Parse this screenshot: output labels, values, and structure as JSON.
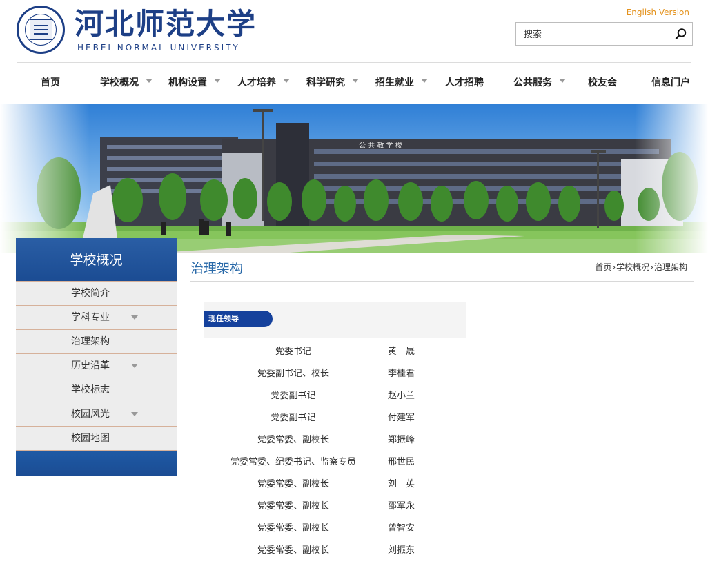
{
  "header": {
    "logo_cn": "河北师范大学",
    "logo_en": "HEBEI NORMAL UNIVERSITY",
    "english_link": "English Version",
    "search_placeholder": "搜索"
  },
  "nav": [
    {
      "label": "首页",
      "dropdown": false
    },
    {
      "label": "学校概况",
      "dropdown": true
    },
    {
      "label": "机构设置",
      "dropdown": true
    },
    {
      "label": "人才培养",
      "dropdown": true
    },
    {
      "label": "科学研究",
      "dropdown": true
    },
    {
      "label": "招生就业",
      "dropdown": true
    },
    {
      "label": "人才招聘",
      "dropdown": false
    },
    {
      "label": "公共服务",
      "dropdown": true
    },
    {
      "label": "校友会",
      "dropdown": false
    },
    {
      "label": "信息门户",
      "dropdown": false
    }
  ],
  "banner": {
    "building_sign": "公 共 教 学 楼"
  },
  "sidebar": {
    "title": "学校概况",
    "items": [
      {
        "label": "学校简介",
        "dropdown": false
      },
      {
        "label": "学科专业",
        "dropdown": true
      },
      {
        "label": "治理架构",
        "dropdown": false
      },
      {
        "label": "历史沿革",
        "dropdown": true
      },
      {
        "label": "学校标志",
        "dropdown": false
      },
      {
        "label": "校园风光",
        "dropdown": true
      },
      {
        "label": "校园地图",
        "dropdown": false
      }
    ]
  },
  "section": {
    "title": "治理架构",
    "breadcrumb": [
      "首页",
      "学校概况",
      "治理架构"
    ],
    "breadcrumb_sep": "›"
  },
  "leaders": {
    "tag": "现任领导",
    "rows": [
      {
        "position": "党委书记",
        "name": "黄　晟"
      },
      {
        "position": "党委副书记、校长",
        "name": "李桂君"
      },
      {
        "position": "党委副书记",
        "name": "赵小兰"
      },
      {
        "position": "党委副书记",
        "name": "付建军"
      },
      {
        "position": "党委常委、副校长",
        "name": "郑振峰"
      },
      {
        "position": "党委常委、纪委书记、监察专员",
        "name": "邢世民"
      },
      {
        "position": "党委常委、副校长",
        "name": "刘　英"
      },
      {
        "position": "党委常委、副校长",
        "name": "邵军永"
      },
      {
        "position": "党委常委、副校长",
        "name": "曾智安"
      },
      {
        "position": "党委常委、副校长",
        "name": "刘振东"
      }
    ]
  },
  "colors": {
    "brand_blue": "#1d3f86",
    "accent_orange": "#e4931e",
    "sidebar_blue": "#1b4c93",
    "title_blue": "#2a6aa9",
    "tag_blue": "#15419c"
  }
}
